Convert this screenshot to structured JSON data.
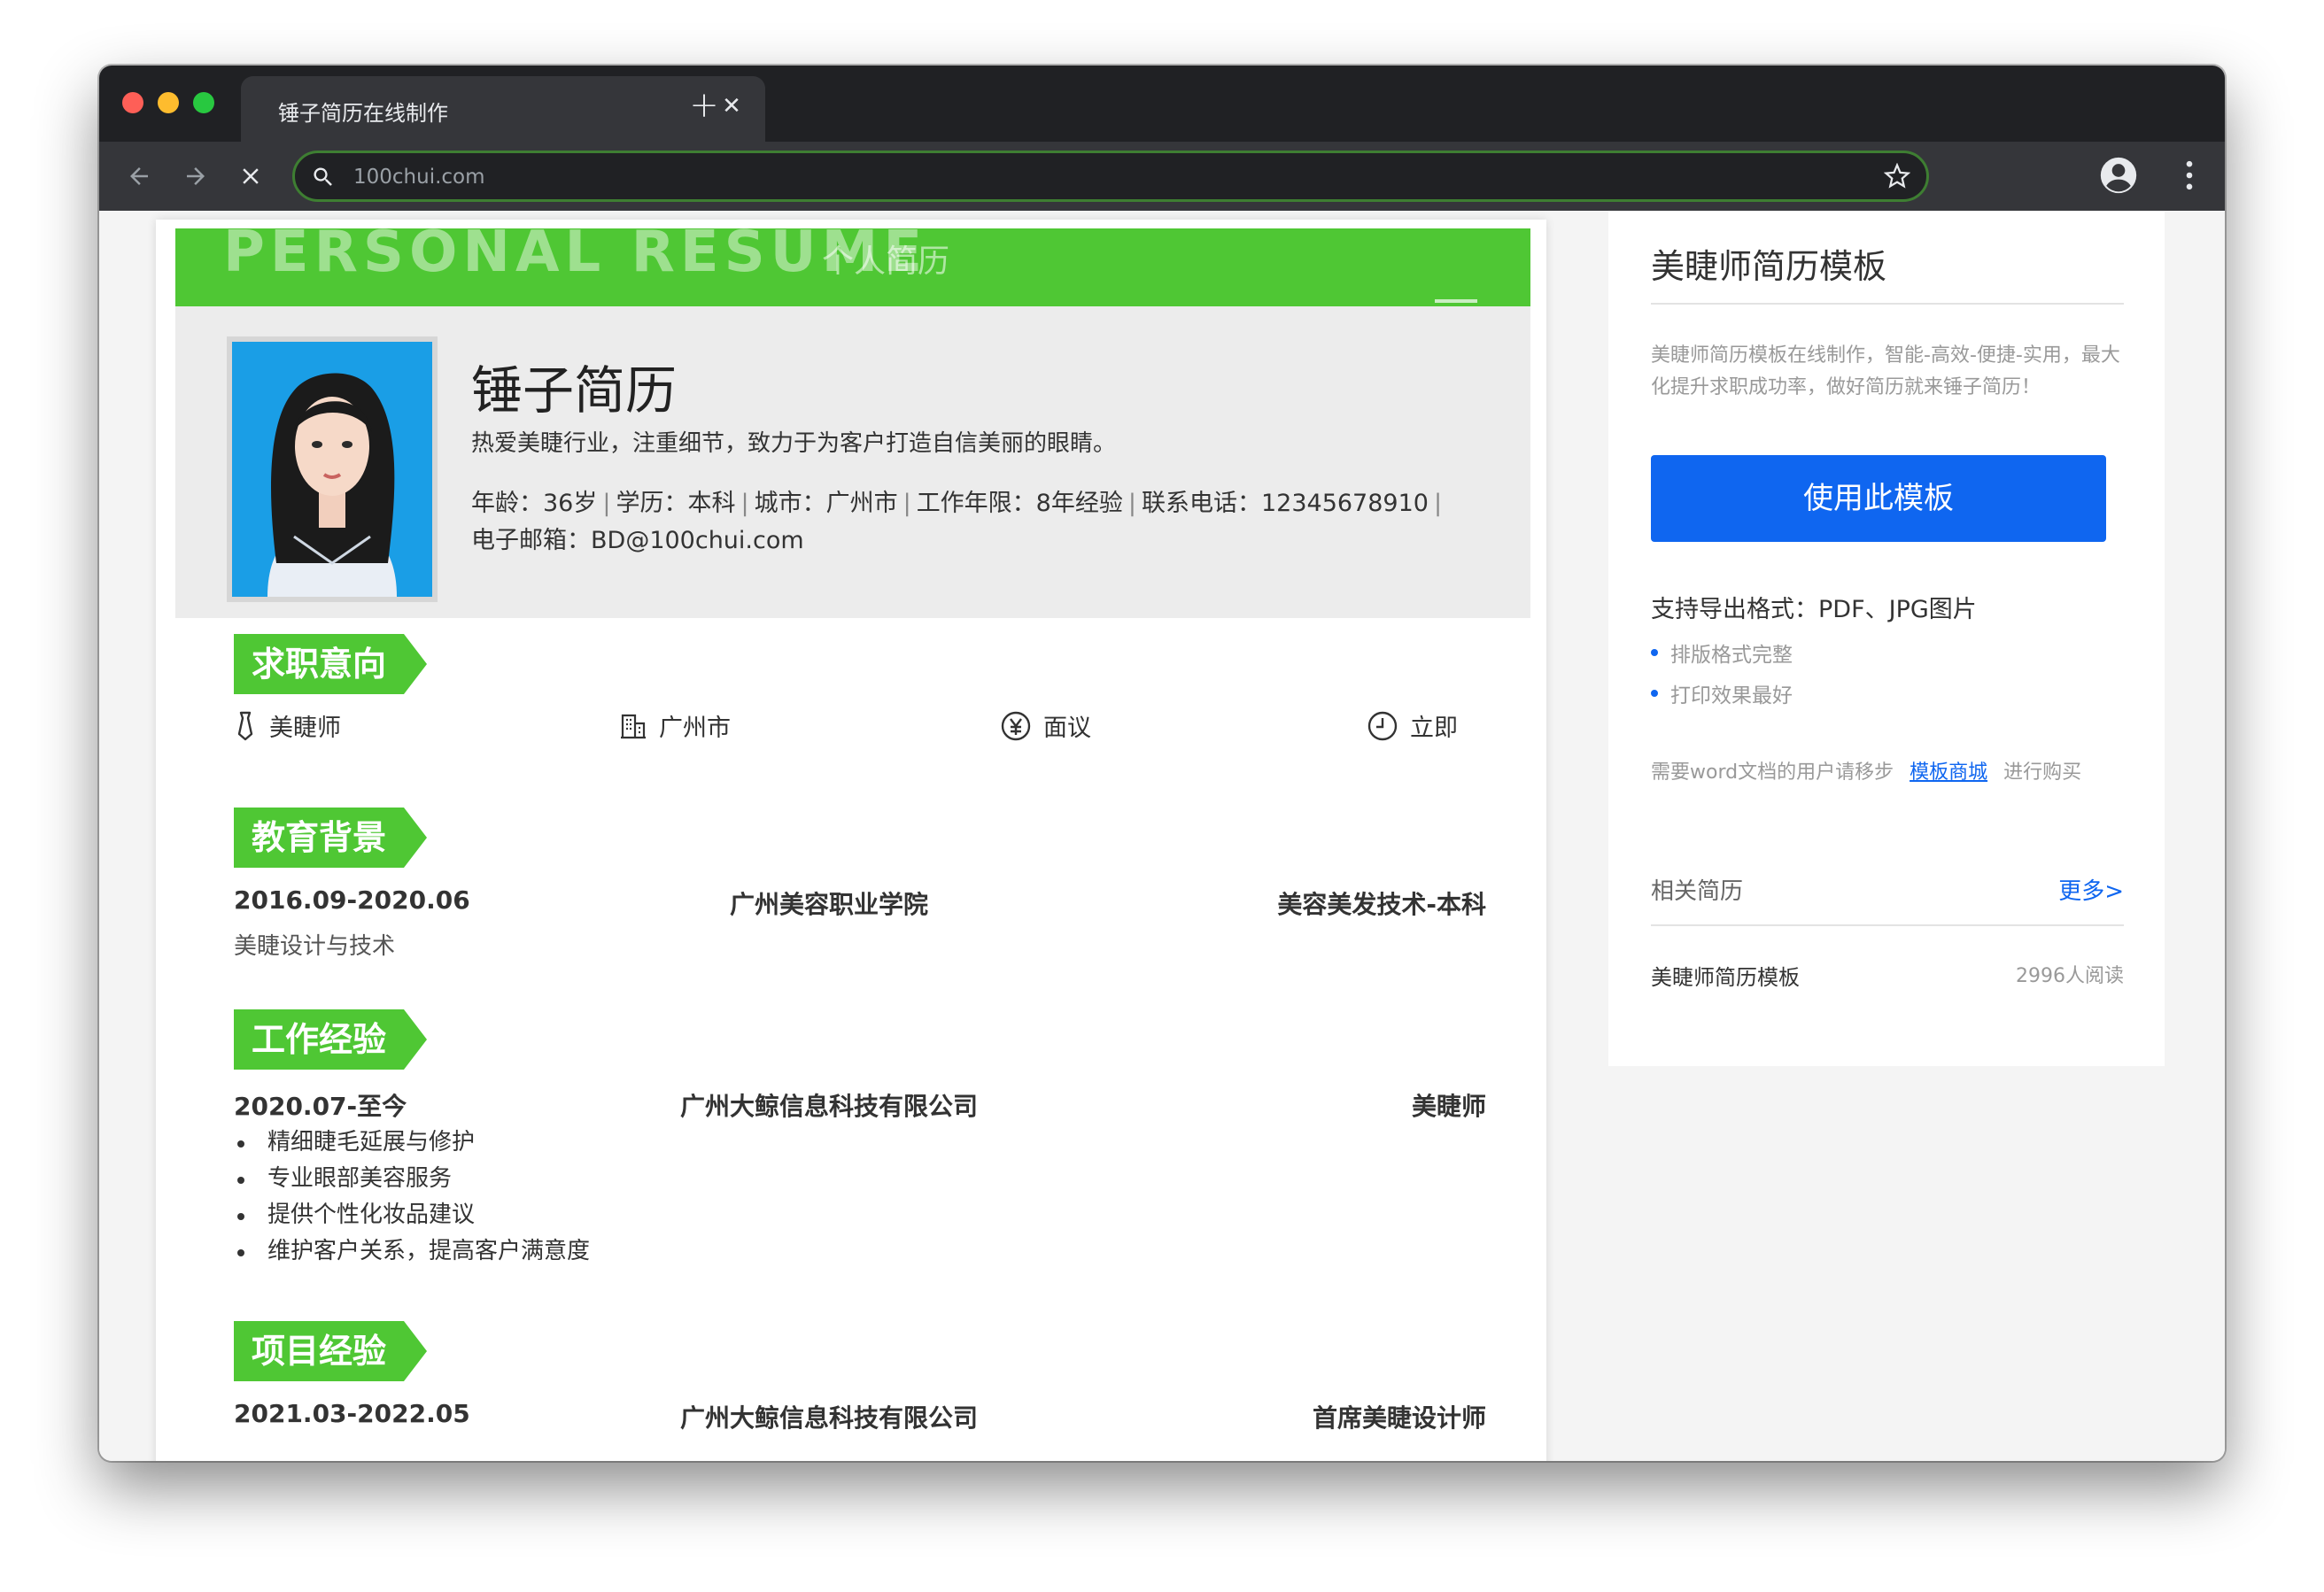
{
  "browser": {
    "tab_title": "锤子简历在线制作",
    "tab_close": "✕",
    "new_tab": "+",
    "url": "100chui.com"
  },
  "resume": {
    "banner_en": "PERSONAL RESUME",
    "banner_cn": "个人简历",
    "name": "锤子简历",
    "motto": "热爱美睫行业，注重细节，致力于为客户打造自信美丽的眼睛。",
    "info": {
      "age": "年龄：36岁",
      "education": "学历：本科",
      "city": "城市：广州市",
      "years": "工作年限：8年经验",
      "phone": "联系电话：12345678910",
      "email": "电子邮箱：BD@100chui.com"
    },
    "sections": {
      "intent": "求职意向",
      "education": "教育背景",
      "work": "工作经验",
      "project": "项目经验"
    },
    "intent": {
      "position": "美睫师",
      "city": "广州市",
      "salary": "面议",
      "availability": "立即"
    },
    "education": {
      "period": "2016.09-2020.06",
      "school": "广州美容职业学院",
      "major": "美容美发技术-本科",
      "desc": "美睫设计与技术"
    },
    "work": {
      "period": "2020.07-至今",
      "company": "广州大鲸信息科技有限公司",
      "title": "美睫师",
      "duties": [
        "精细睫毛延展与修护",
        "专业眼部美容服务",
        "提供个性化妆品建议",
        "维护客户关系，提高客户满意度"
      ]
    },
    "project": {
      "period": "2021.03-2022.05",
      "company": "广州大鲸信息科技有限公司",
      "title": "首席美睫设计师"
    }
  },
  "sidebar": {
    "title": "美睫师简历模板",
    "desc": "美睫师简历模板在线制作，智能-高效-便捷-实用，最大化提升求职成功率，做好简历就来锤子简历！",
    "use_button": "使用此模板",
    "formats": "支持导出格式：PDF、JPG图片",
    "features": [
      "排版格式完整",
      "打印效果最好"
    ],
    "word_prefix": "需要word文档的用户请移步",
    "word_link": "模板商城",
    "word_suffix": "进行购买",
    "related_label": "相关简历",
    "more_link": "更多>",
    "related_items": [
      {
        "name": "美睫师简历模板",
        "reads": "2996人阅读"
      }
    ]
  },
  "colors": {
    "accent_green": "#4fc734",
    "button_blue": "#0f66f0",
    "chrome_dark": "#202124",
    "chrome_tab": "#35363a"
  }
}
